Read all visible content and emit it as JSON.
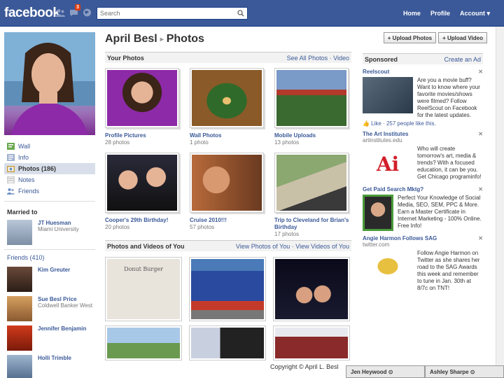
{
  "topbar": {
    "logo": "facebook",
    "notification_count": "3",
    "search_placeholder": "Search",
    "nav": [
      "Home",
      "Profile",
      "Account ▾"
    ]
  },
  "left_nav": {
    "items": [
      {
        "label": "Wall",
        "icon": "wall-icon"
      },
      {
        "label": "Info",
        "icon": "info-icon"
      },
      {
        "label": "Photos (186)",
        "icon": "photos-icon",
        "active": true
      },
      {
        "label": "Notes",
        "icon": "notes-icon"
      },
      {
        "label": "Friends",
        "icon": "friends-icon"
      }
    ],
    "married_label": "Married to",
    "spouse": {
      "name": "JT Huesman",
      "sub": "Miami University"
    },
    "friends_label": "Friends (410)",
    "friends": [
      {
        "name": "Kim Greuter",
        "sub": ""
      },
      {
        "name": "Sue Besl Price",
        "sub": "Coldwell Banker West"
      },
      {
        "name": "Jennifer Benjamin",
        "sub": ""
      },
      {
        "name": "Holli Trimble",
        "sub": ""
      }
    ]
  },
  "main": {
    "title_owner": "April Besl",
    "title_section": "Photos",
    "upload_photos": "+ Upload Photos",
    "upload_video": "+ Upload Video",
    "your_photos_label": "Your Photos",
    "your_photos_links": "See All Photos · Video",
    "albums": [
      {
        "name": "Profile Pictures",
        "count": "28 photos"
      },
      {
        "name": "Wall Photos",
        "count": "1 photo"
      },
      {
        "name": "Mobile Uploads",
        "count": "13 photos"
      },
      {
        "name": "Cooper's 29th Birthday!",
        "count": "20 photos"
      },
      {
        "name": "Cruise 2010!!!",
        "count": "57 photos"
      },
      {
        "name": "Trip to Cleveland for Brian's Birthday",
        "count": "17 photos"
      }
    ],
    "tagged_label": "Photos and Videos of You",
    "tagged_links": "View Photos of You · View Videos of You",
    "tagged_sign_text": "Donut Burger"
  },
  "sponsored": {
    "label": "Sponsored",
    "create_ad": "Create an Ad",
    "ads": [
      {
        "title": "Reelscout",
        "sub": "",
        "text": "Are you a movie buff? Want to know where your favorite movies/shows were filmed? Follow ReelScout on Facebook for the latest updates.",
        "like": "👍 Like · 257 people like this."
      },
      {
        "title": "The Art Institutes",
        "sub": "artinstitutes.edu",
        "text": "Who will create tomorrow's art, media & trends? With a focused education, it can be you. Get Chicago programinfo!",
        "like": ""
      },
      {
        "title": "Get Paid Search Mktg?",
        "sub": "",
        "text": "Perfect Your Knowledge of Social Media, SEO, SEM, PPC & More. Earn a Master Certificate in Internet Marketing - 100% Online. Free Info!",
        "like": ""
      },
      {
        "title": "Angie Harmon Follows SAG",
        "sub": "twitter.com",
        "text": "Follow Angie Harmon on Twitter as she shares her road to the SAG Awards this week and remember to tune in Jan. 30th at 8/7c on TNT!",
        "like": ""
      }
    ]
  },
  "chat": [
    "Jen Heywood ⊙",
    "Ashley Sharpe ⊙"
  ],
  "copyright": "Copyright © April L. Besl"
}
